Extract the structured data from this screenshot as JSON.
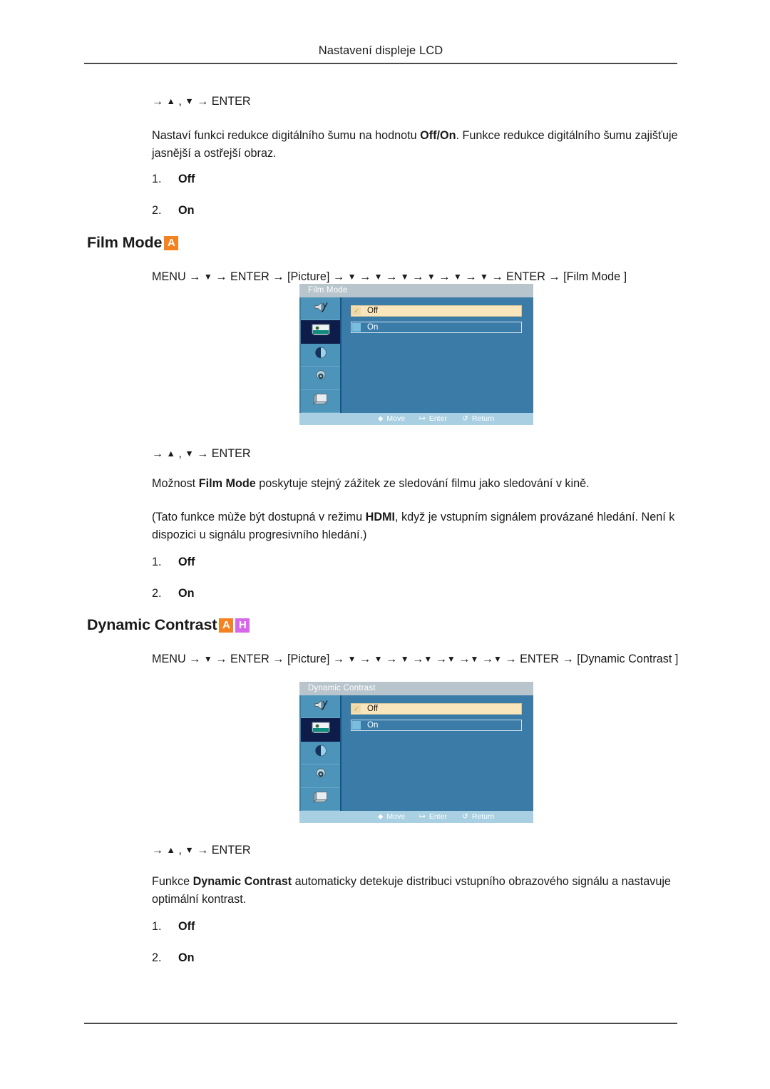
{
  "header": {
    "running_title": "Nastavení displeje LCD"
  },
  "blocks": {
    "noise_key_line": {
      "prefix": "→",
      "up": "▲",
      "comma": ",",
      "down": "▼",
      "arrow2": "→",
      "enter": "ENTER"
    },
    "noise_desc_part1": "Nastaví funkci redukce digitálního šumu na hodnotu ",
    "noise_desc_bold": "Off/On",
    "noise_desc_part2": ". Funkce redukce digitálního šumu zajišťuje jasnější a ostřejší obraz.",
    "noise_options": [
      {
        "num": "1.",
        "value": "Off"
      },
      {
        "num": "2.",
        "value": "On"
      }
    ]
  },
  "film_mode": {
    "heading": "Film Mode",
    "badges": [
      {
        "letter": "A",
        "color": "#f58220"
      }
    ],
    "menu_path": {
      "menu": "MENU",
      "enter": "ENTER",
      "picture": "[Picture]",
      "target": "[Film Mode ]",
      "down_count": 6
    },
    "key_line": {
      "prefix": "→",
      "up": "▲",
      "comma": ",",
      "down": "▼",
      "arrow2": "→",
      "enter": "ENTER"
    },
    "desc_part1": "Možnost ",
    "desc_bold": "Film Mode",
    "desc_part2": " poskytuje stejný zážitek ze sledování filmu jako sledování v kině.",
    "note_part1": "(Tato funkce mùže být dostupná v režimu ",
    "note_bold": "HDMI",
    "note_part2": ", když je vstupním signálem provázané hledání. Není k dispozici u signálu progresivního hledání.)",
    "options": [
      {
        "num": "1.",
        "value": "Off"
      },
      {
        "num": "2.",
        "value": "On"
      }
    ],
    "osd": {
      "title": "Film Mode",
      "rows": [
        {
          "label": "Off",
          "selected": true
        },
        {
          "label": "On",
          "selected": false
        }
      ],
      "footer": [
        {
          "icon": "move-icon",
          "glyph": "⬥",
          "label": "Move"
        },
        {
          "icon": "enter-icon",
          "glyph": "↦",
          "label": "Enter"
        },
        {
          "icon": "return-icon",
          "glyph": "↺",
          "label": "Return"
        }
      ],
      "sidebar_icons": [
        {
          "name": "sound-icon",
          "selected": false
        },
        {
          "name": "picture-icon",
          "selected": true
        },
        {
          "name": "contrast-icon",
          "selected": false
        },
        {
          "name": "setup-icon",
          "selected": false
        },
        {
          "name": "input-icon",
          "selected": false
        }
      ]
    }
  },
  "dynamic_contrast": {
    "heading": "Dynamic Contrast",
    "badges": [
      {
        "letter": "A",
        "color": "#f58220"
      },
      {
        "letter": "H",
        "color": "#d866e8"
      }
    ],
    "menu_path": {
      "menu": "MENU",
      "enter": "ENTER",
      "picture": "[Picture]",
      "target": "[Dynamic Contrast ]",
      "down_count": 7
    },
    "key_line": {
      "prefix": "→",
      "up": "▲",
      "comma": ",",
      "down": "▼",
      "arrow2": "→",
      "enter": "ENTER"
    },
    "desc_part1": "Funkce ",
    "desc_bold": "Dynamic Contrast",
    "desc_part2": " automaticky detekuje distribuci vstupního obrazového signálu a nastavuje optimální kontrast.",
    "options": [
      {
        "num": "1.",
        "value": "Off"
      },
      {
        "num": "2.",
        "value": "On"
      }
    ],
    "osd": {
      "title": "Dynamic Contrast",
      "rows": [
        {
          "label": "Off",
          "selected": true
        },
        {
          "label": "On",
          "selected": false
        }
      ],
      "footer": [
        {
          "icon": "move-icon",
          "glyph": "⬥",
          "label": "Move"
        },
        {
          "icon": "enter-icon",
          "glyph": "↦",
          "label": "Enter"
        },
        {
          "icon": "return-icon",
          "glyph": "↺",
          "label": "Return"
        }
      ],
      "sidebar_icons": [
        {
          "name": "sound-icon",
          "selected": false
        },
        {
          "name": "picture-icon",
          "selected": true
        },
        {
          "name": "contrast-icon",
          "selected": false
        },
        {
          "name": "setup-icon",
          "selected": false
        },
        {
          "name": "input-icon",
          "selected": false
        }
      ]
    }
  }
}
